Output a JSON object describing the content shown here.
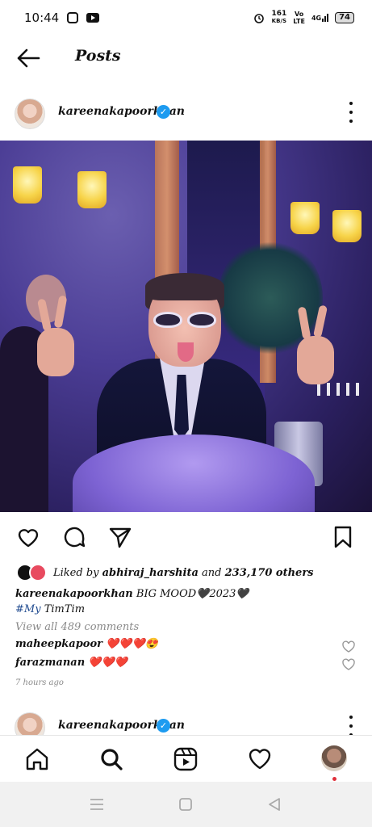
{
  "status_bar": {
    "time": "10:44",
    "net_speed_value": "161",
    "net_speed_unit": "KB/S",
    "network_label_top": "Vo",
    "network_label_bottom": "LTE",
    "network_type": "4G",
    "battery": "74"
  },
  "header": {
    "title": "Posts"
  },
  "post": {
    "username": "kareenakapoorkhan",
    "liked_by_prefix": "Liked by",
    "liked_by_user": "abhiraj_harshita",
    "liked_by_and": "and",
    "liked_by_others": "233,170 others",
    "caption_user": "kareenakapoorkhan",
    "caption_text": "BIG MOOD🖤2023🖤",
    "caption_hashtag": "#My",
    "caption_rest": "TimTim",
    "view_comments": "View all 489 comments",
    "comments": [
      {
        "user": "maheepkapoor",
        "text": "❤️❤️❤️😍"
      },
      {
        "user": "farazmanan",
        "text": "❤️❤️❤️"
      }
    ],
    "time_ago": "7 hours ago"
  },
  "next_post": {
    "username": "kareenakapoorkhan"
  },
  "colors": {
    "verified": "#1d9bf0",
    "hashtag": "#1f4a8f",
    "notification_dot": "#e0303a"
  },
  "icons": {
    "actions": [
      "heart-icon",
      "comment-icon",
      "share-icon",
      "bookmark-icon"
    ],
    "nav": [
      "home-icon",
      "search-icon",
      "reels-icon",
      "activity-heart-icon",
      "profile-avatar"
    ],
    "system": [
      "menu-icon",
      "home-square-icon",
      "back-triangle-icon"
    ]
  }
}
